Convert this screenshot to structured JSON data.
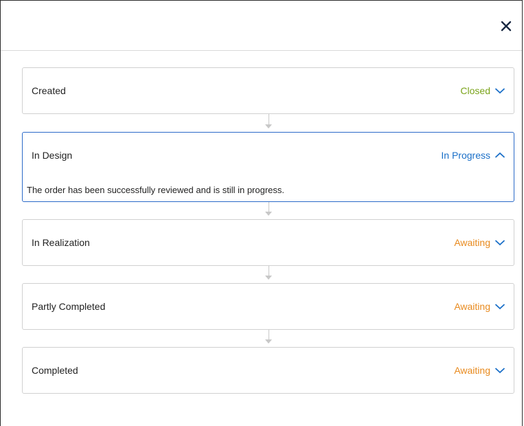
{
  "dialog": {
    "close_icon": "close-icon"
  },
  "steps": [
    {
      "title": "Created",
      "status": "Closed",
      "status_type": "closed",
      "expanded": false,
      "chevron": "chevron-down-icon"
    },
    {
      "title": "In Design",
      "status": "In Progress",
      "status_type": "progress",
      "expanded": true,
      "chevron": "chevron-up-icon",
      "description": "The order has been successfully reviewed and is still in progress."
    },
    {
      "title": "In Realization",
      "status": "Awaiting",
      "status_type": "awaiting",
      "expanded": false,
      "chevron": "chevron-down-icon"
    },
    {
      "title": "Partly Completed",
      "status": "Awaiting",
      "status_type": "awaiting",
      "expanded": false,
      "chevron": "chevron-down-icon"
    },
    {
      "title": "Completed",
      "status": "Awaiting",
      "status_type": "awaiting",
      "expanded": false,
      "chevron": "chevron-down-icon"
    }
  ],
  "colors": {
    "closed": "#7aa31a",
    "progress": "#1a6fc8",
    "awaiting": "#e88a1e",
    "active_border": "#2a69c8",
    "chevron": "#1a6fc8"
  }
}
